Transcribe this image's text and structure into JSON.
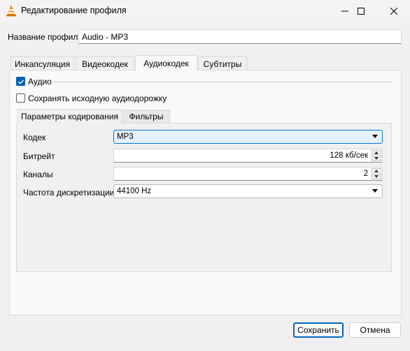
{
  "window": {
    "title": "Редактирование профиля",
    "icon": "vlc-cone-icon",
    "controls": [
      "minimize-icon",
      "maximize-icon",
      "close-icon"
    ]
  },
  "profile": {
    "name_label": "Название профиля",
    "name_value": "Audio - MP3"
  },
  "tabs": [
    {
      "label": "Инкапсуляция",
      "active": false
    },
    {
      "label": "Видеокодек",
      "active": false
    },
    {
      "label": "Аудиокодек",
      "active": true
    },
    {
      "label": "Субтитры",
      "active": false
    }
  ],
  "audio": {
    "enabled_label": "Аудио",
    "enabled": true,
    "keep_original_label": "Сохранять исходную аудиодорожку",
    "keep_original": false
  },
  "subtabs": [
    {
      "label": "Параметры кодирования",
      "active": true
    },
    {
      "label": "Фильтры",
      "active": false
    }
  ],
  "encoding": {
    "codec_label": "Кодек",
    "codec_value": "MP3",
    "bitrate_label": "Битрейт",
    "bitrate_value": "128 кб/сек",
    "channels_label": "Каналы",
    "channels_value": "2",
    "samplerate_label": "Частота дискретизации",
    "samplerate_value": "44100 Hz"
  },
  "buttons": {
    "save": "Сохранить",
    "cancel": "Отмена"
  },
  "colors": {
    "accent": "#005fb8",
    "focus_fill": "#e5f1fb",
    "vlc_orange": "#f48b00"
  }
}
